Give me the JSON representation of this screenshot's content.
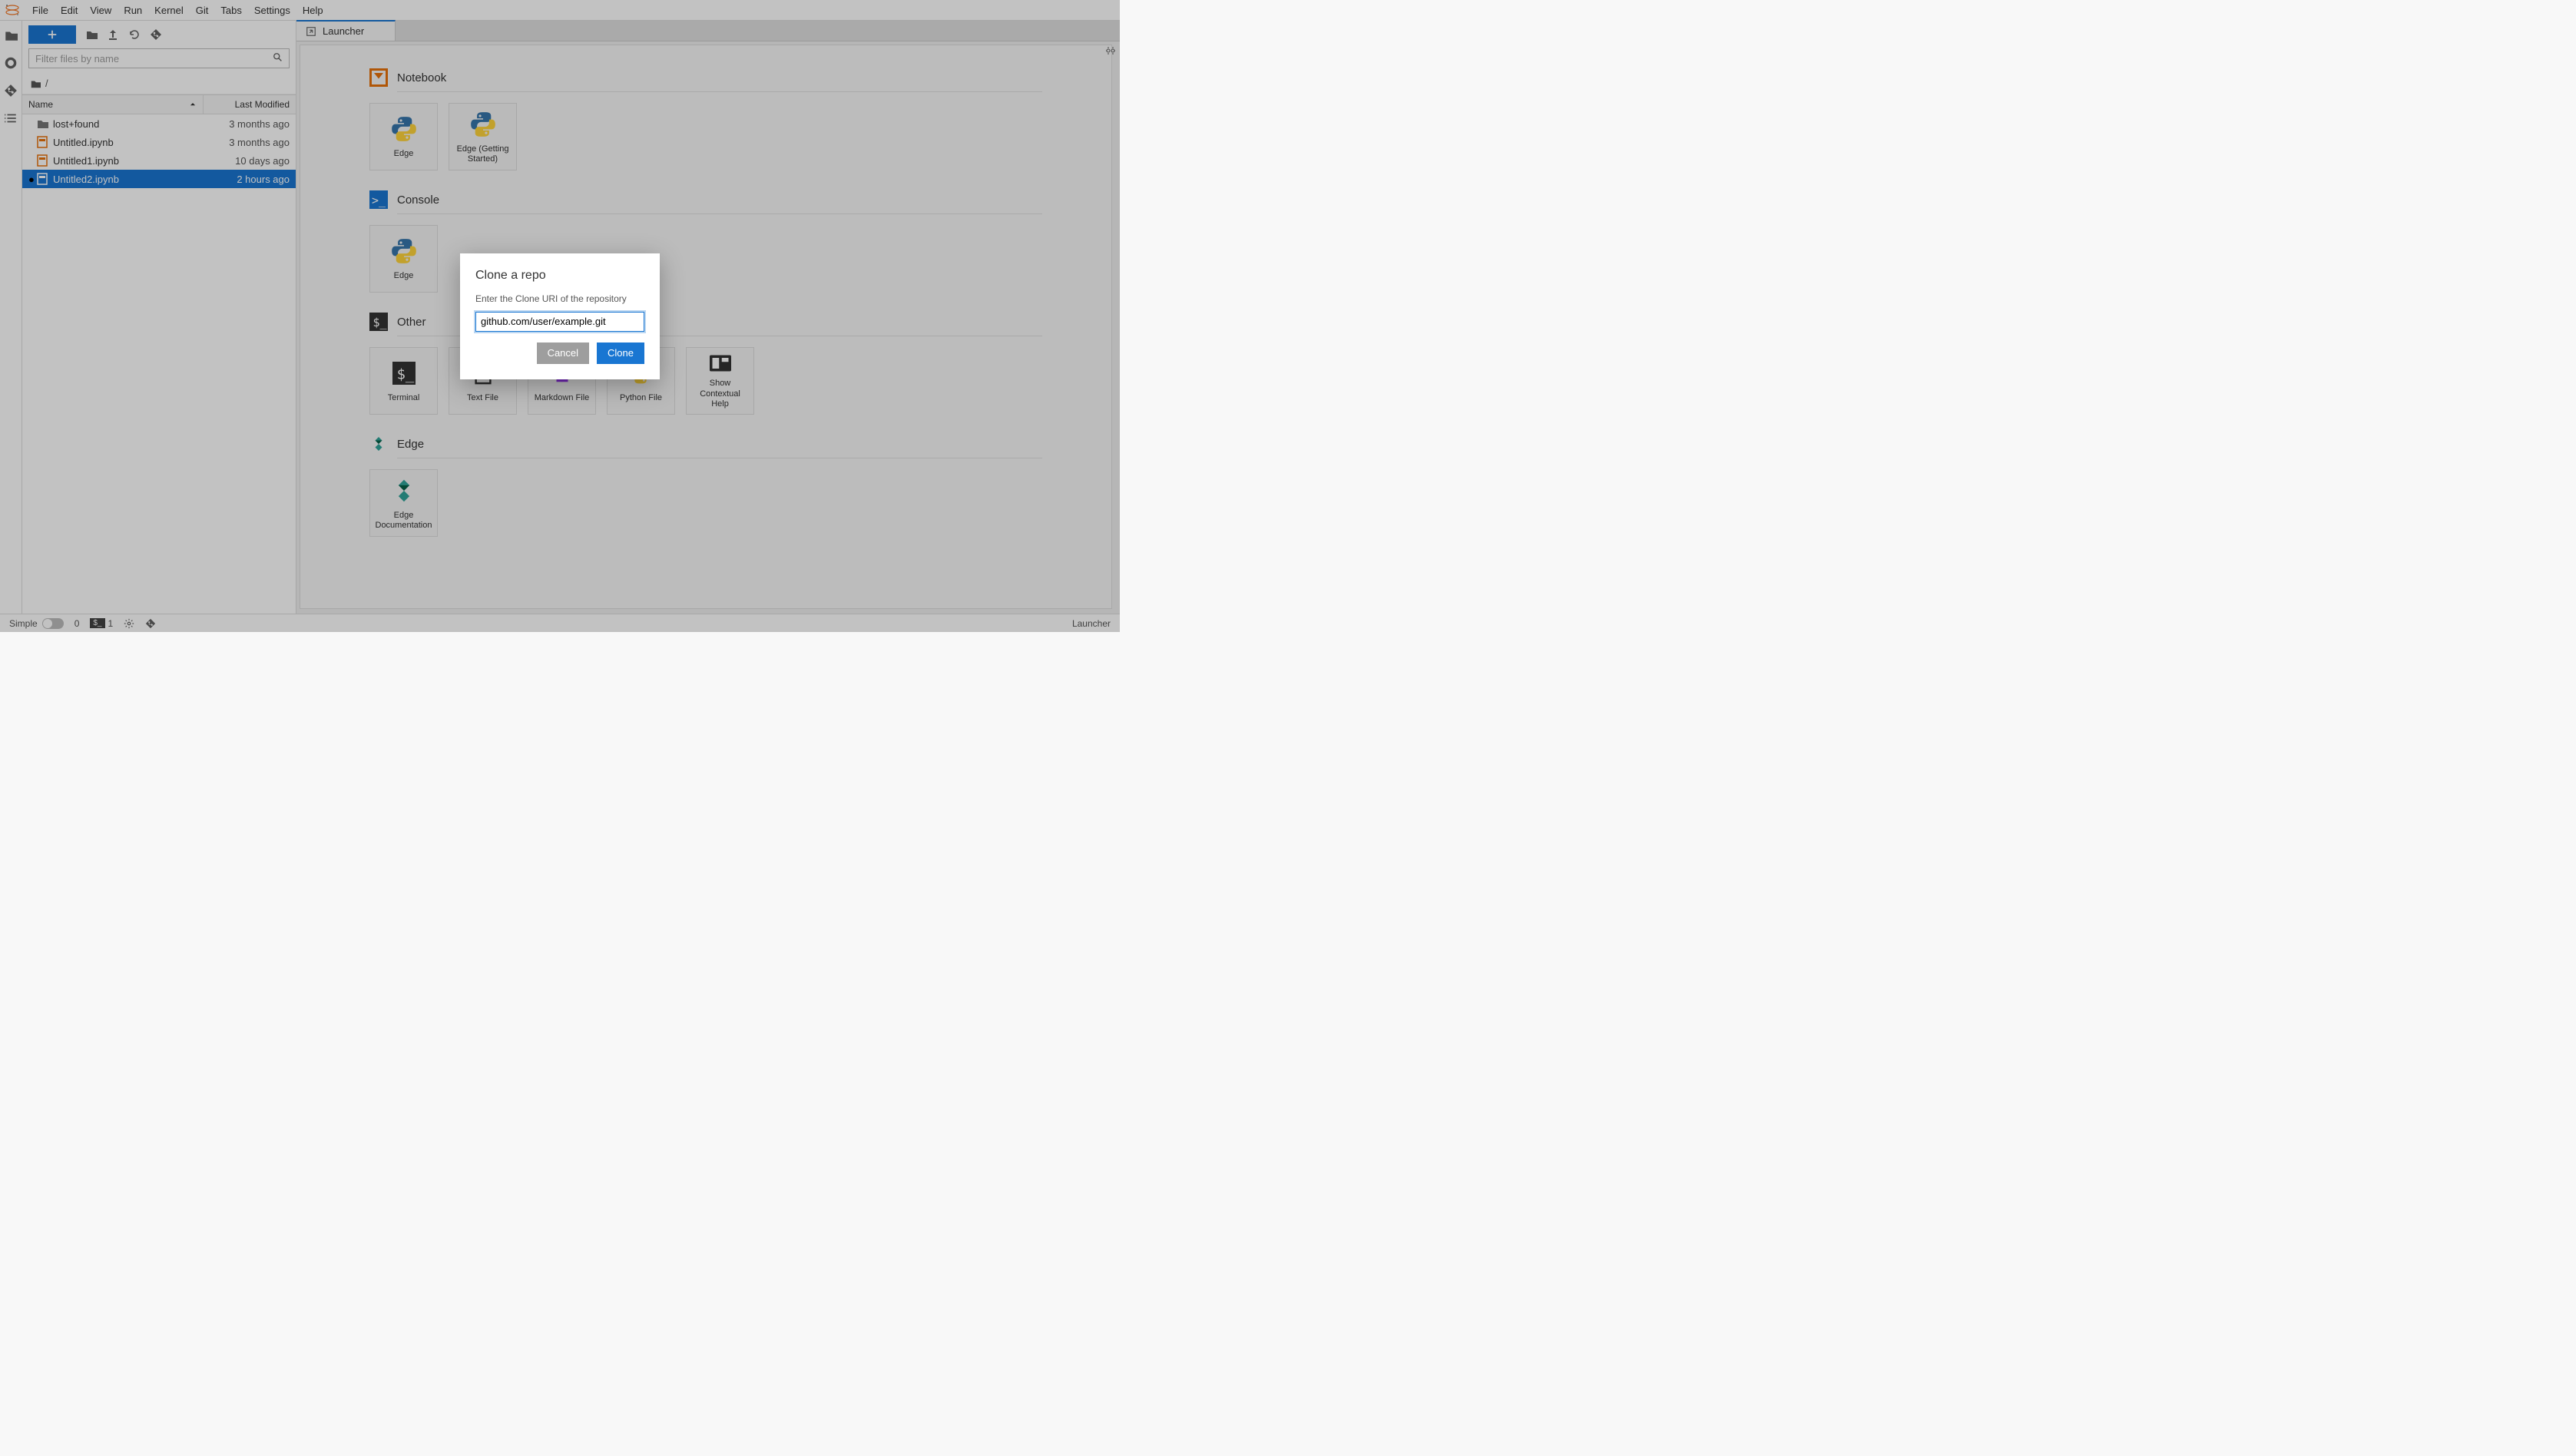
{
  "menus": [
    "File",
    "Edit",
    "View",
    "Run",
    "Kernel",
    "Git",
    "Tabs",
    "Settings",
    "Help"
  ],
  "filebrowser": {
    "filter_placeholder": "Filter files by name",
    "breadcrumb_root": "/",
    "columns": {
      "name": "Name",
      "modified": "Last Modified"
    },
    "rows": [
      {
        "icon": "folder",
        "name": "lost+found",
        "modified": "3 months ago",
        "selected": false,
        "dirty": false
      },
      {
        "icon": "notebook",
        "name": "Untitled.ipynb",
        "modified": "3 months ago",
        "selected": false,
        "dirty": false
      },
      {
        "icon": "notebook",
        "name": "Untitled1.ipynb",
        "modified": "10 days ago",
        "selected": false,
        "dirty": false
      },
      {
        "icon": "notebook",
        "name": "Untitled2.ipynb",
        "modified": "2 hours ago",
        "selected": true,
        "dirty": true
      }
    ]
  },
  "tab": {
    "label": "Launcher"
  },
  "launcher": {
    "sections": {
      "notebook": {
        "title": "Notebook",
        "cards": [
          "Edge",
          "Edge (Getting Started)"
        ]
      },
      "console": {
        "title": "Console",
        "cards": [
          "Edge"
        ]
      },
      "other": {
        "title": "Other",
        "cards": [
          "Terminal",
          "Text File",
          "Markdown File",
          "Python File",
          "Show Contextual Help"
        ]
      },
      "edge": {
        "title": "Edge",
        "cards": [
          "Edge Documentation"
        ]
      }
    }
  },
  "dialog": {
    "title": "Clone a repo",
    "message": "Enter the Clone URI of the repository",
    "value": "github.com/user/example.git",
    "cancel": "Cancel",
    "confirm": "Clone"
  },
  "statusbar": {
    "simple": "Simple",
    "count0": "0",
    "term_count": "1",
    "right": "Launcher"
  }
}
